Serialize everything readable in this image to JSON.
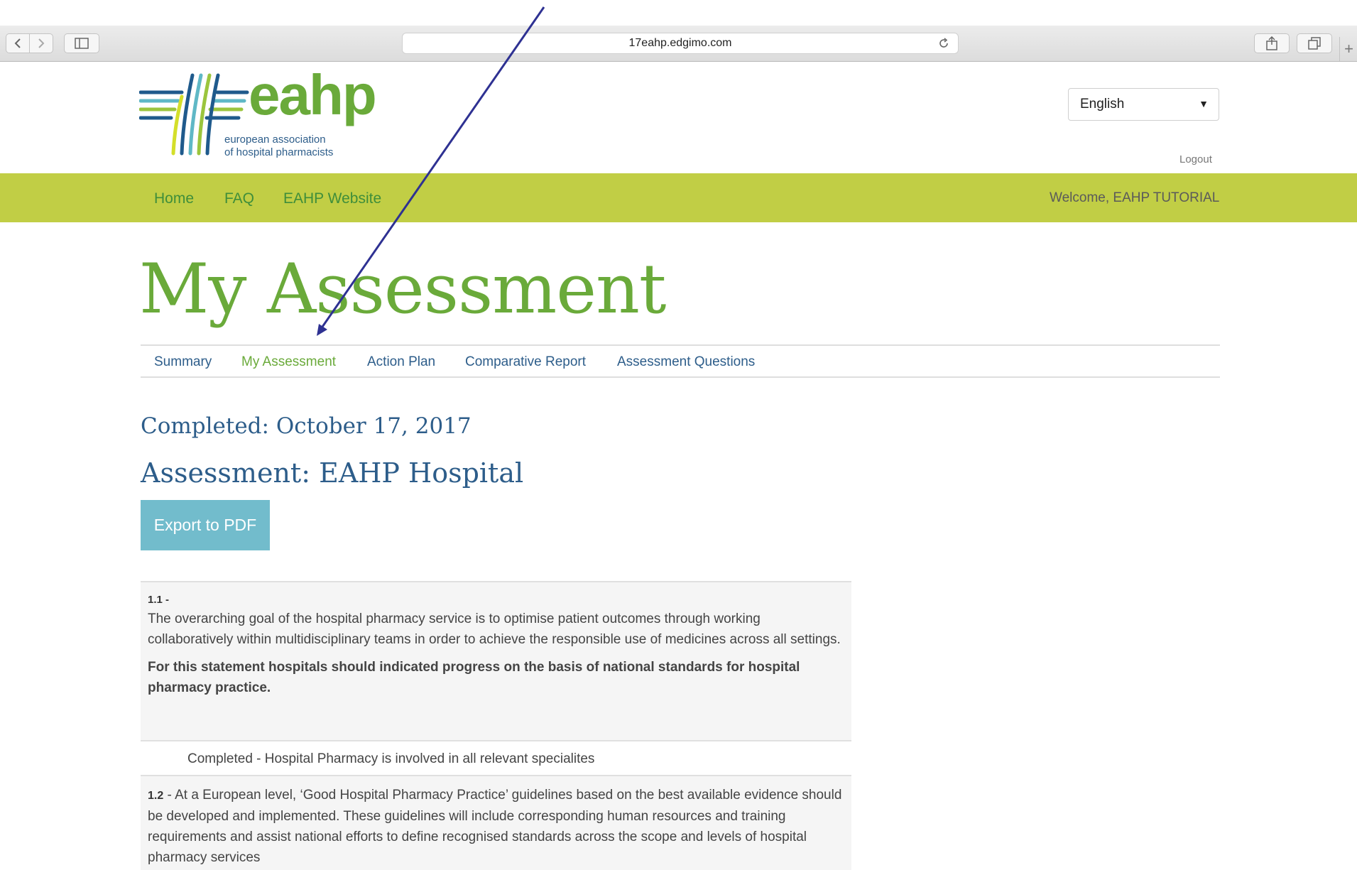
{
  "browser": {
    "url": "17eahp.edgimo.com"
  },
  "header": {
    "logo_word": "eahp",
    "logo_sub_line1": "european association",
    "logo_sub_line2": "of hospital pharmacists",
    "language": "English",
    "logout": "Logout",
    "welcome": "Welcome, EAHP TUTORIAL",
    "nav": [
      "Home",
      "FAQ",
      "EAHP Website"
    ]
  },
  "colors": {
    "brand_green": "#6aaa3a",
    "nav_bar": "#c1ce45",
    "heading_blue": "#2d5d8a",
    "export_button": "#72bccc",
    "annotation_arrow": "#2e3192"
  },
  "page": {
    "title": "My Assessment",
    "tabs": [
      {
        "label": "Summary",
        "active": false
      },
      {
        "label": "My Assessment",
        "active": true
      },
      {
        "label": "Action Plan",
        "active": false
      },
      {
        "label": "Comparative Report",
        "active": false
      },
      {
        "label": "Assessment Questions",
        "active": false
      }
    ],
    "completed": "Completed: October 17, 2017",
    "assessment": "Assessment: EAHP Hospital",
    "export_label": "Export to PDF"
  },
  "questions": [
    {
      "number": "1.1",
      "separator": " -",
      "text": "The overarching goal of the hospital pharmacy service is to optimise patient outcomes through working collaboratively within multidisciplinary teams in order to achieve the responsible use of medicines across all settings.",
      "note": "For this statement hospitals should indicated progress on the basis of national standards for hospital pharmacy practice.",
      "answer": "Completed - Hospital Pharmacy is involved in all relevant specialites"
    },
    {
      "number": "1.2",
      "separator": " - ",
      "text": "At a European level, ‘Good Hospital Pharmacy Practice’ guidelines based on the best available evidence should be developed and implemented. These guidelines will include corresponding human resources and training requirements and assist national efforts to define recognised standards across the scope and levels of hospital pharmacy services"
    }
  ]
}
